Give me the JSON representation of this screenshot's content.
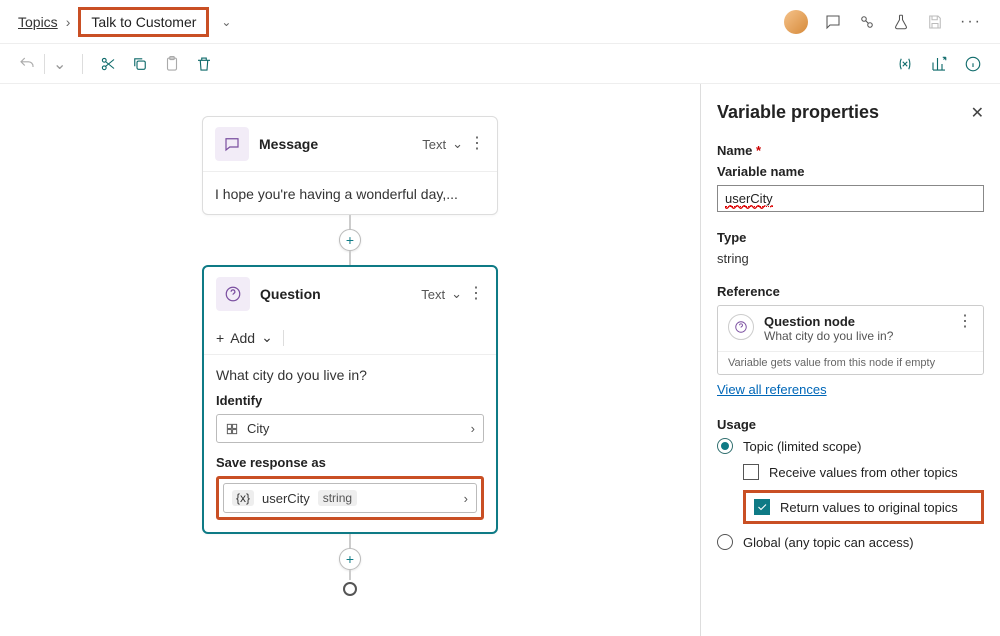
{
  "header": {
    "breadcrumb_root": "Topics",
    "breadcrumb_current": "Talk to Customer"
  },
  "canvas": {
    "message_node": {
      "title": "Message",
      "type_label": "Text",
      "body": "I hope you're having a wonderful day,..."
    },
    "question_node": {
      "title": "Question",
      "type_label": "Text",
      "add_label": "Add",
      "prompt": "What city do you live in?",
      "identify_label": "Identify",
      "identify_value": "City",
      "save_label": "Save response as",
      "var_name": "userCity",
      "var_type": "string"
    }
  },
  "panel": {
    "title": "Variable properties",
    "name_label": "Name",
    "name_sublabel": "Variable name",
    "name_value": "userCity",
    "type_label": "Type",
    "type_value": "string",
    "reference_label": "Reference",
    "ref_title": "Question node",
    "ref_sub": "What city do you live in?",
    "ref_footer": "Variable gets value from this node if empty",
    "view_all": "View all references",
    "usage_label": "Usage",
    "opt_topic": "Topic (limited scope)",
    "opt_receive": "Receive values from other topics",
    "opt_return": "Return values to original topics",
    "opt_global": "Global (any topic can access)"
  }
}
